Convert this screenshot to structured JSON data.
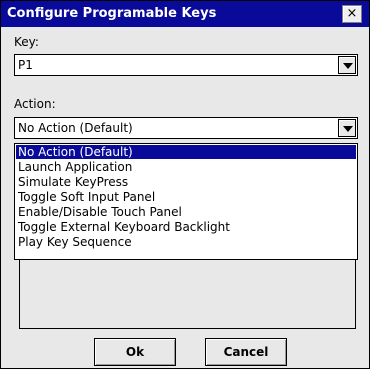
{
  "window": {
    "title": "Configure Programable Keys",
    "close_label": "×"
  },
  "key": {
    "label": "Key:",
    "value": "P1"
  },
  "action": {
    "label": "Action:",
    "value": "No Action (Default)",
    "options": [
      "No Action (Default)",
      "Launch Application",
      "Simulate KeyPress",
      "Toggle Soft Input Panel",
      "Enable/Disable Touch Panel",
      "Toggle External Keyboard Backlight",
      "Play Key Sequence"
    ],
    "selected_index": 0
  },
  "buttons": {
    "ok": "Ok",
    "cancel": "Cancel"
  },
  "colors": {
    "titlebar": "#0a0a9a",
    "selection": "#0a0a9a",
    "dialog_bg": "#e8e8e8"
  }
}
